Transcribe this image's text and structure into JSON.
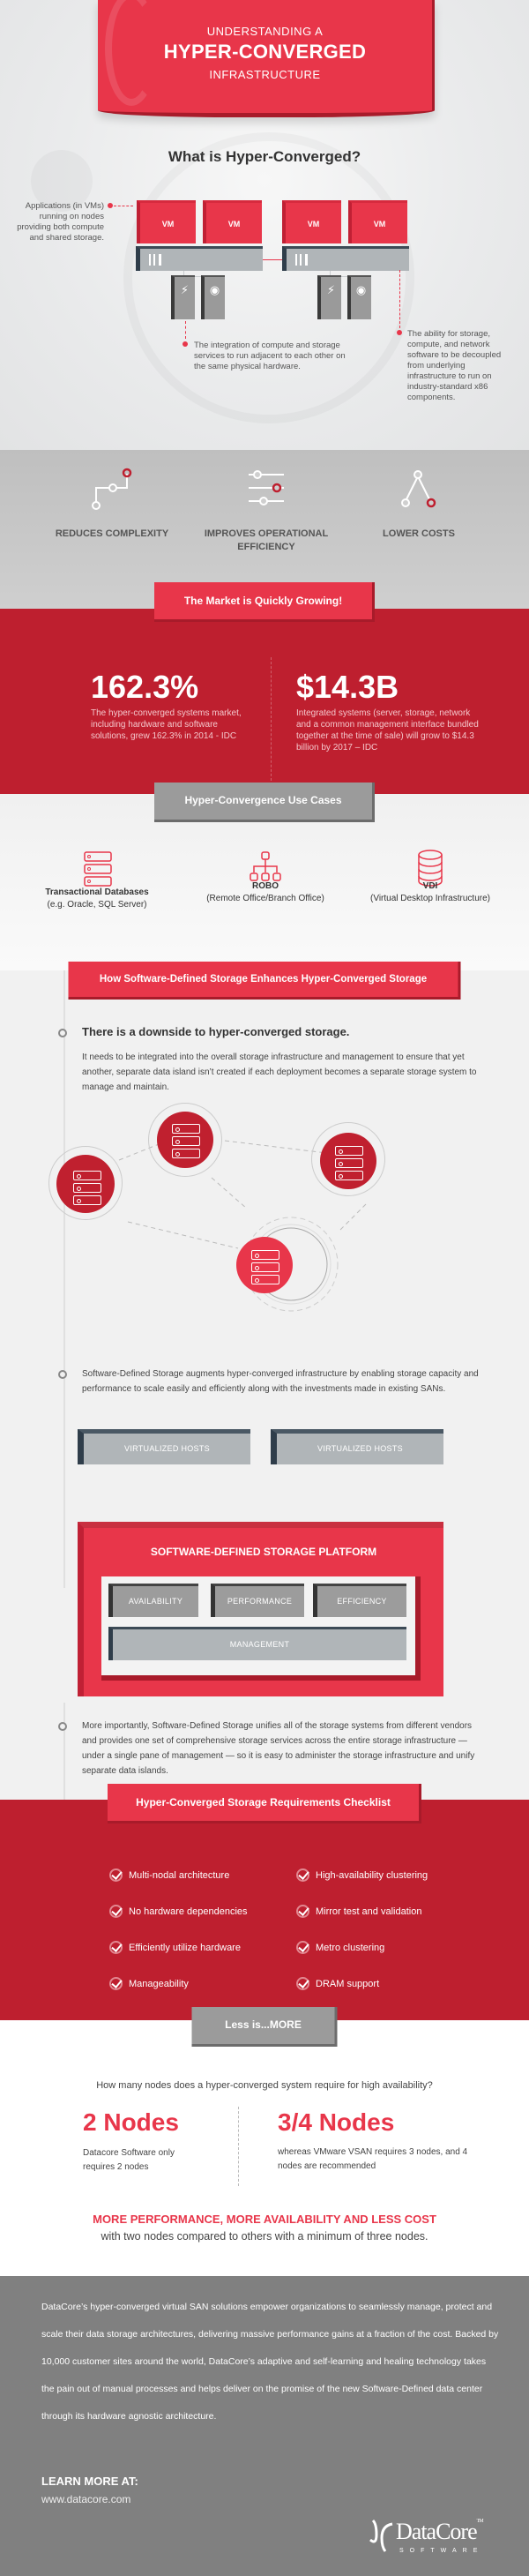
{
  "hero": {
    "title_line1": "UNDERSTANDING A",
    "title_line2": "HYPER-CONVERGED",
    "title_line3": "INFRASTRUCTURE",
    "question": "What is Hyper-Converged?",
    "vm_label": "VM",
    "annotation_left": "Applications (in VMs) running on nodes providing both compute and shared storage.",
    "annotation_center": "The integration of compute and storage services to run adjacent to each other on the same physical hardware.",
    "annotation_right": "The ability for storage, compute, and network software to be decoupled from underlying infrastructure to run on industry-standard x86 components.",
    "tower_icons": [
      "lightning-icon",
      "disc-icon"
    ]
  },
  "benefits": [
    {
      "label": "REDUCES COMPLEXITY",
      "icon": "circuit-path-icon"
    },
    {
      "label": "IMPROVES OPERATIONAL EFFICIENCY",
      "icon": "sliders-icon"
    },
    {
      "label": "LOWER COSTS",
      "icon": "branch-icon"
    }
  ],
  "market": {
    "heading": "The Market is Quickly Growing!",
    "stats": [
      {
        "value": "162.3%",
        "desc": "The hyper-converged systems market, including hardware and software solutions, grew 162.3% in 2014 - IDC"
      },
      {
        "value": "$14.3B",
        "desc": "Integrated systems (server, storage, network and a common management interface bundled together at the time of sale) will grow to $14.3 billion by 2017 – IDC"
      }
    ]
  },
  "use_cases": {
    "heading": "Hyper-Convergence Use Cases",
    "items": [
      {
        "title": "Transactional Databases",
        "sub": "(e.g. Oracle, SQL Server)",
        "icon": "server-stack-icon"
      },
      {
        "title": "ROBO",
        "sub": "(Remote Office/Branch Office)",
        "icon": "org-chart-icon"
      },
      {
        "title": "VDI",
        "sub": "(Virtual Desktop Infrastructure)",
        "icon": "database-icon"
      }
    ]
  },
  "sds": {
    "heading": "How Software-Defined Storage Enhances Hyper-Converged Storage",
    "point1_title": "There is a downside to hyper-converged storage.",
    "point1_body": "It needs to be integrated into the overall storage infrastructure and management to ensure that yet another, separate data island isn’t created if each deployment becomes a separate storage system to manage and maintain.",
    "point2_body": "Software-Defined Storage augments hyper-converged infrastructure by enabling storage capacity and performance to scale easily and efficiently along with the investments made in existing SANs.",
    "hosts": [
      "VIRTUALIZED HOSTS",
      "VIRTUALIZED HOSTS"
    ],
    "platform_title": "SOFTWARE-DEFINED STORAGE PLATFORM",
    "platform_boxes": [
      "AVAILABILITY",
      "PERFORMANCE",
      "EFFICIENCY"
    ],
    "management": "MANAGEMENT",
    "point3_body": "More importantly, Software-Defined Storage unifies all of the storage systems from different vendors and provides one set of comprehensive storage services across the entire storage infrastructure — under a single pane of management — so it is easy to administer the storage infrastructure and unify separate data islands."
  },
  "checklist": {
    "heading": "Hyper-Converged Storage Requirements Checklist",
    "left": [
      "Multi-nodal architecture",
      "No hardware dependencies",
      "Efficiently utilize hardware",
      "Manageability"
    ],
    "right": [
      "High-availability clustering",
      "Mirror test and validation",
      "Metro clustering",
      "DRAM support"
    ]
  },
  "less": {
    "heading": "Less is...MORE",
    "question": "How many nodes does a hyper-converged system require for high availability?",
    "left_big": "2 Nodes",
    "left_desc": "Datacore Software only requires 2 nodes",
    "right_big": "3/4 Nodes",
    "right_desc": "whereas VMware VSAN requires 3 nodes, and 4 nodes are recommended",
    "tagline": "MORE PERFORMANCE, MORE AVAILABILITY AND LESS COST",
    "tagline_sub": "with two nodes compared to others with a minimum of three nodes."
  },
  "footer": {
    "about": "DataCore’s hyper-converged virtual SAN solutions empower organizations to seamlessly manage, protect and scale their data storage architectures, delivering massive performance gains at a fraction of the cost. Backed by 10,000 customer sites around the world, DataCore’s adaptive and self-learning and healing technology takes the pain out of manual processes and helps deliver on the promise of the new Software-Defined data center through its hardware agnostic architecture.",
    "learn_more": "LEARN MORE AT:",
    "url": "www.datacore.com",
    "logo_brand": "DataCore",
    "logo_tm": "TM",
    "logo_sub": "SOFTWARE"
  },
  "colors": {
    "accent": "#e8364a",
    "dark_red": "#be1f2f",
    "grey_tab": "#9b9b9b",
    "footer": "#808080"
  }
}
